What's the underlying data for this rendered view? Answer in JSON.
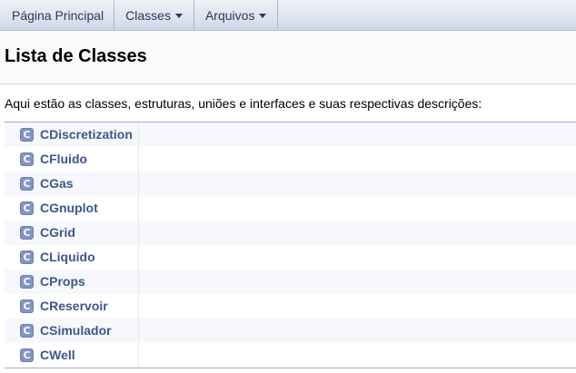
{
  "nav": {
    "items": [
      {
        "label": "Página Principal",
        "has_dropdown": false
      },
      {
        "label": "Classes",
        "has_dropdown": true
      },
      {
        "label": "Arquivos",
        "has_dropdown": true
      }
    ]
  },
  "header": {
    "title": "Lista de Classes"
  },
  "description": "Aqui estão as classes, estruturas, uniões e interfaces e suas respectivas descrições:",
  "class_list": {
    "icon_letter": "C",
    "items": [
      {
        "name": "CDiscretization",
        "description": ""
      },
      {
        "name": "CFluido",
        "description": ""
      },
      {
        "name": "CGas",
        "description": ""
      },
      {
        "name": "CGnuplot",
        "description": ""
      },
      {
        "name": "CGrid",
        "description": ""
      },
      {
        "name": "CLiquido",
        "description": ""
      },
      {
        "name": "CProps",
        "description": ""
      },
      {
        "name": "CReservoir",
        "description": ""
      },
      {
        "name": "CSimulador",
        "description": ""
      },
      {
        "name": "CWell",
        "description": ""
      }
    ]
  },
  "colors": {
    "link": "#3d578c",
    "icon_bg": "#8295c3",
    "row_alt": "#f7f8fb",
    "nav_text": "#283a5d"
  }
}
